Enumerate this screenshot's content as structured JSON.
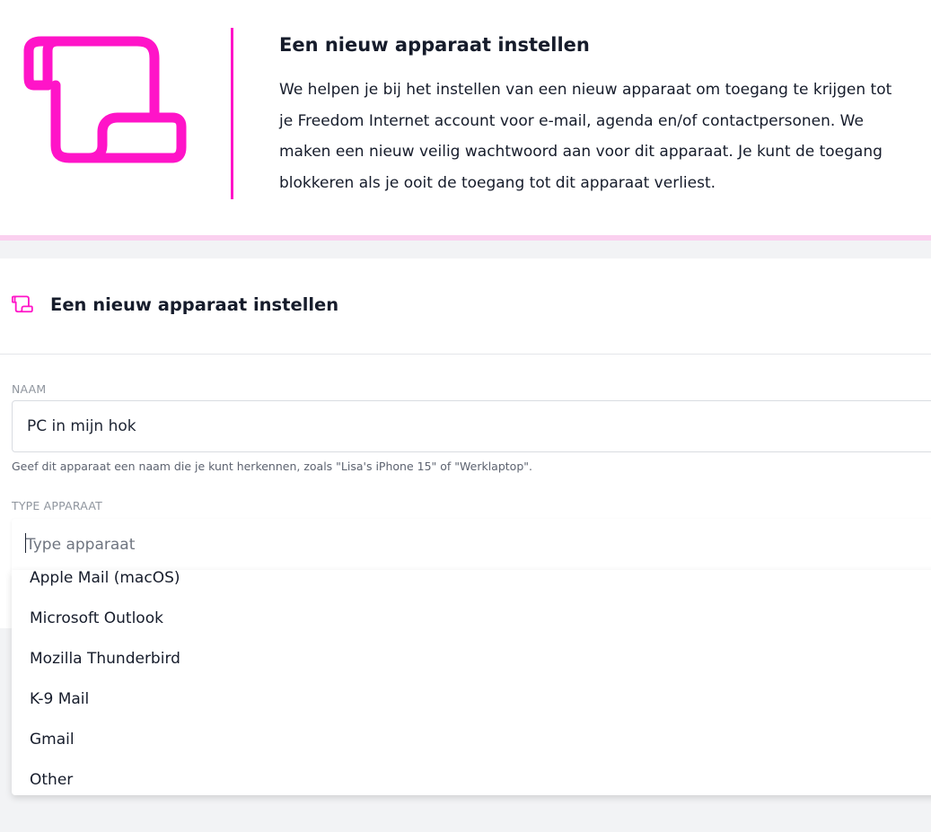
{
  "intro": {
    "title": "Een nieuw apparaat instellen",
    "description": "We helpen je bij het instellen van een nieuw apparaat om toegang te krijgen tot je Freedom Internet account voor e-mail, agenda en/of contactpersonen. We maken een nieuw veilig wachtwoord aan voor dit apparaat. Je kunt de toegang blokkeren als je ooit de toegang tot dit apparaat verliest.",
    "icon": "scroll-icon"
  },
  "card": {
    "title": "Een nieuw apparaat instellen",
    "icon": "scroll-icon"
  },
  "form": {
    "name": {
      "label": "NAAM",
      "value": "PC in mijn hok",
      "help": "Geef dit apparaat een naam die je kunt herkennen, zoals \"Lisa's iPhone 15\" of \"Werklaptop\"."
    },
    "type": {
      "label": "TYPE APPARAAT",
      "value": "",
      "placeholder": "Type apparaat",
      "options": [
        "Apple Mail (macOS)",
        "Microsoft Outlook",
        "Mozilla Thunderbird",
        "K-9 Mail",
        "Gmail",
        "Other"
      ]
    }
  },
  "colors": {
    "accent": "#ff14c8",
    "accent_light": "#fad0ef",
    "text": "#161c2b",
    "muted": "#8f959e",
    "background": "#f2f3f5"
  }
}
